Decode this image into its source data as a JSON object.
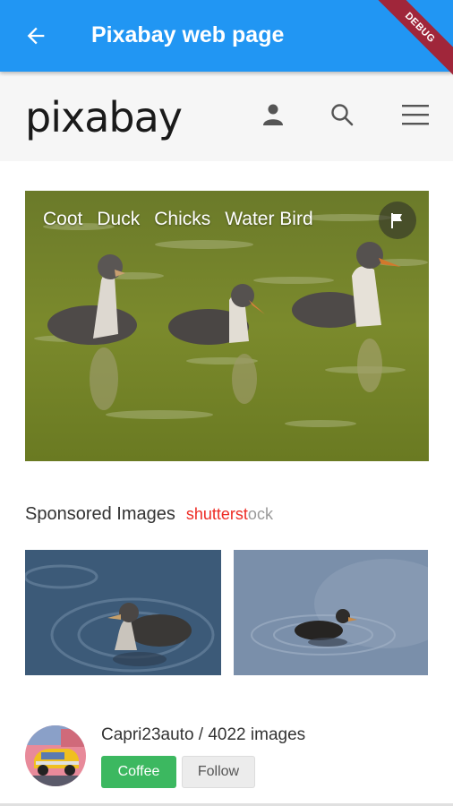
{
  "appbar": {
    "title": "Pixabay web page",
    "back_icon": "arrow-left-icon",
    "debug_banner": "DEBUG",
    "color": "#2196f3"
  },
  "site_header": {
    "logo": "pixabay",
    "icons": [
      "user-icon",
      "search-icon",
      "menu-icon"
    ]
  },
  "hero": {
    "tags": [
      "Coot",
      "Duck",
      "Chicks",
      "Water Bird"
    ],
    "flag_icon": "flag-icon"
  },
  "sponsored": {
    "label": "Sponsored Images",
    "brand_red": "shutterst",
    "brand_o": "o",
    "brand_rest": "ck"
  },
  "profile": {
    "username": "Capri23auto / 4022 images",
    "coffee_label": "Coffee",
    "follow_label": "Follow",
    "coffee_color": "#3cb860"
  }
}
